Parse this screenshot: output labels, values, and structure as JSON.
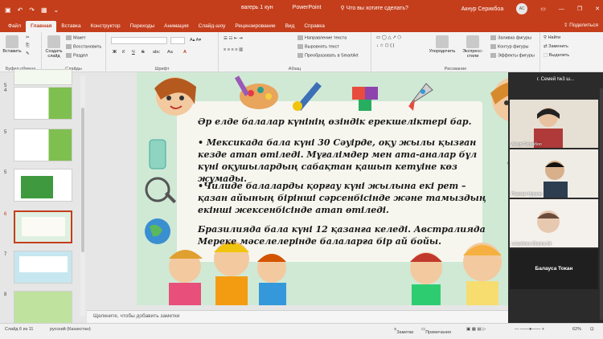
{
  "window": {
    "file_title": "вагерь 1 кун",
    "app_name": "PowerPoint",
    "search_hint": "Что вы хотите сделать?",
    "user": "Акнур Серикбоа",
    "user_initials": "АС",
    "accent": "#c43e1c"
  },
  "tabs": [
    "Файл",
    "Главная",
    "Вставка",
    "Конструктор",
    "Переходы",
    "Анимация",
    "Слайд-шоу",
    "Рецензирование",
    "Вид",
    "Справка"
  ],
  "active_tab": "Главная",
  "share_label": "Поделиться",
  "ribbon": {
    "clipboard": {
      "paste": "Вставить",
      "label": "Буфер обмена"
    },
    "slides": {
      "create": "Создать слайд",
      "layout": "Макет",
      "reset": "Восстановить",
      "section": "Раздел",
      "label": "Слайды"
    },
    "font": {
      "label": "Шрифт",
      "bold": "Ж",
      "italic": "К",
      "underline": "Ч",
      "strike": "S",
      "spacing": "abc",
      "size_case": "Аа"
    },
    "paragraph": {
      "label": "Абзац",
      "direction": "Направление текста",
      "align": "Выровнять текст",
      "smartart": "Преобразовать в SmartArt"
    },
    "drawing": {
      "label": "Рисование",
      "arrange": "Упорядочить",
      "express": "Экспресс-стили",
      "fill": "Заливка фигуры",
      "outline": "Контур фигуры",
      "effects": "Эффекты фигуры"
    },
    "editing": {
      "find": "Найти",
      "replace": "Заменить",
      "select": "Выделить"
    }
  },
  "thumbnails": [
    {
      "num": "5",
      "active": false
    },
    {
      "num": "4",
      "active": false
    },
    {
      "num": "5",
      "active": false
    },
    {
      "num": "6",
      "active": true
    },
    {
      "num": "7",
      "active": false
    },
    {
      "num": "8",
      "active": false
    }
  ],
  "slide": {
    "heading": "Әр елде балалар күнінің өзіндік ерекшеліктері бар.",
    "p1": "• Мексикада бала күні 30 Сәуірде, оқу жылы қызған кезде атап өтіледі. Мұғалімдер мен ата-аналар бұл күні оқушылардың сабақтан қашып кетуіне көз жұмады.",
    "p2": "•Чилиде балаларды қорғау күні жылына екі рет – қазан айының бірінші сәрсенбісінде және тамыздың екінші жексенбісінде атап өтіледі.",
    "p3": "Бразилияда бала күні 12 қазанға келеді. Австралияда Мереке мәселелерінде балаларға бір ай бойы."
  },
  "notes_placeholder": "Щелкните, чтобы добавить заметки",
  "status": {
    "slide_counter": "Слайд 6 из 11",
    "language": "русский (Казахстан)",
    "notes": "Заметки",
    "comments": "Примечания",
    "zoom": "62%"
  },
  "video_panel": {
    "title": "г. Семей №3 ш...",
    "participants": [
      "Акнур Серикбол",
      "Перизат Нурали",
      "Lukashova Zhanna 34"
    ],
    "bottom_name": "Балауса Токан"
  }
}
